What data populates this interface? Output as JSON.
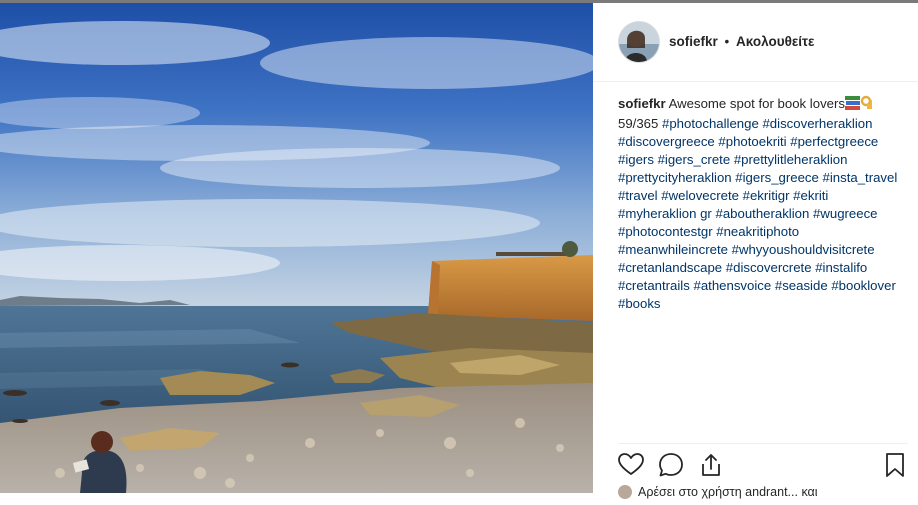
{
  "post": {
    "username": "sofiefkr",
    "separator": "•",
    "follow_label": "Ακολουθείτε",
    "caption": {
      "username": "sofiefkr",
      "text": "Awesome spot for book lovers",
      "emojis": [
        "books-emoji",
        "ok-hand-emoji"
      ],
      "count_line": "59/365",
      "hashtags": "#photochallenge #discoverheraklion #discovergreece #photoekriti #perfectgreece #igers #igers_crete #prettylitleheraklion #prettycityheraklion #igers_greece #insta_travel #travel #welovecrete #ekritigr #ekriti #myheraklion gr #aboutheraklion #wugreece #photocontestgr #neakritiphoto #meanwhileincrete #whyyoushouldvisitcrete #cretanlandscape #discovercrete #instalifo #cretantrails #athensvoice #seaside #booklover #books"
    },
    "likes_text": "Αρέσει στο χρήστη andrant... και"
  },
  "actions": {
    "like": "heart-icon",
    "comment": "comment-icon",
    "share": "share-icon",
    "save": "bookmark-icon"
  },
  "colors": {
    "text": "#262626",
    "hashtag": "#003569",
    "divider": "#efefef"
  }
}
